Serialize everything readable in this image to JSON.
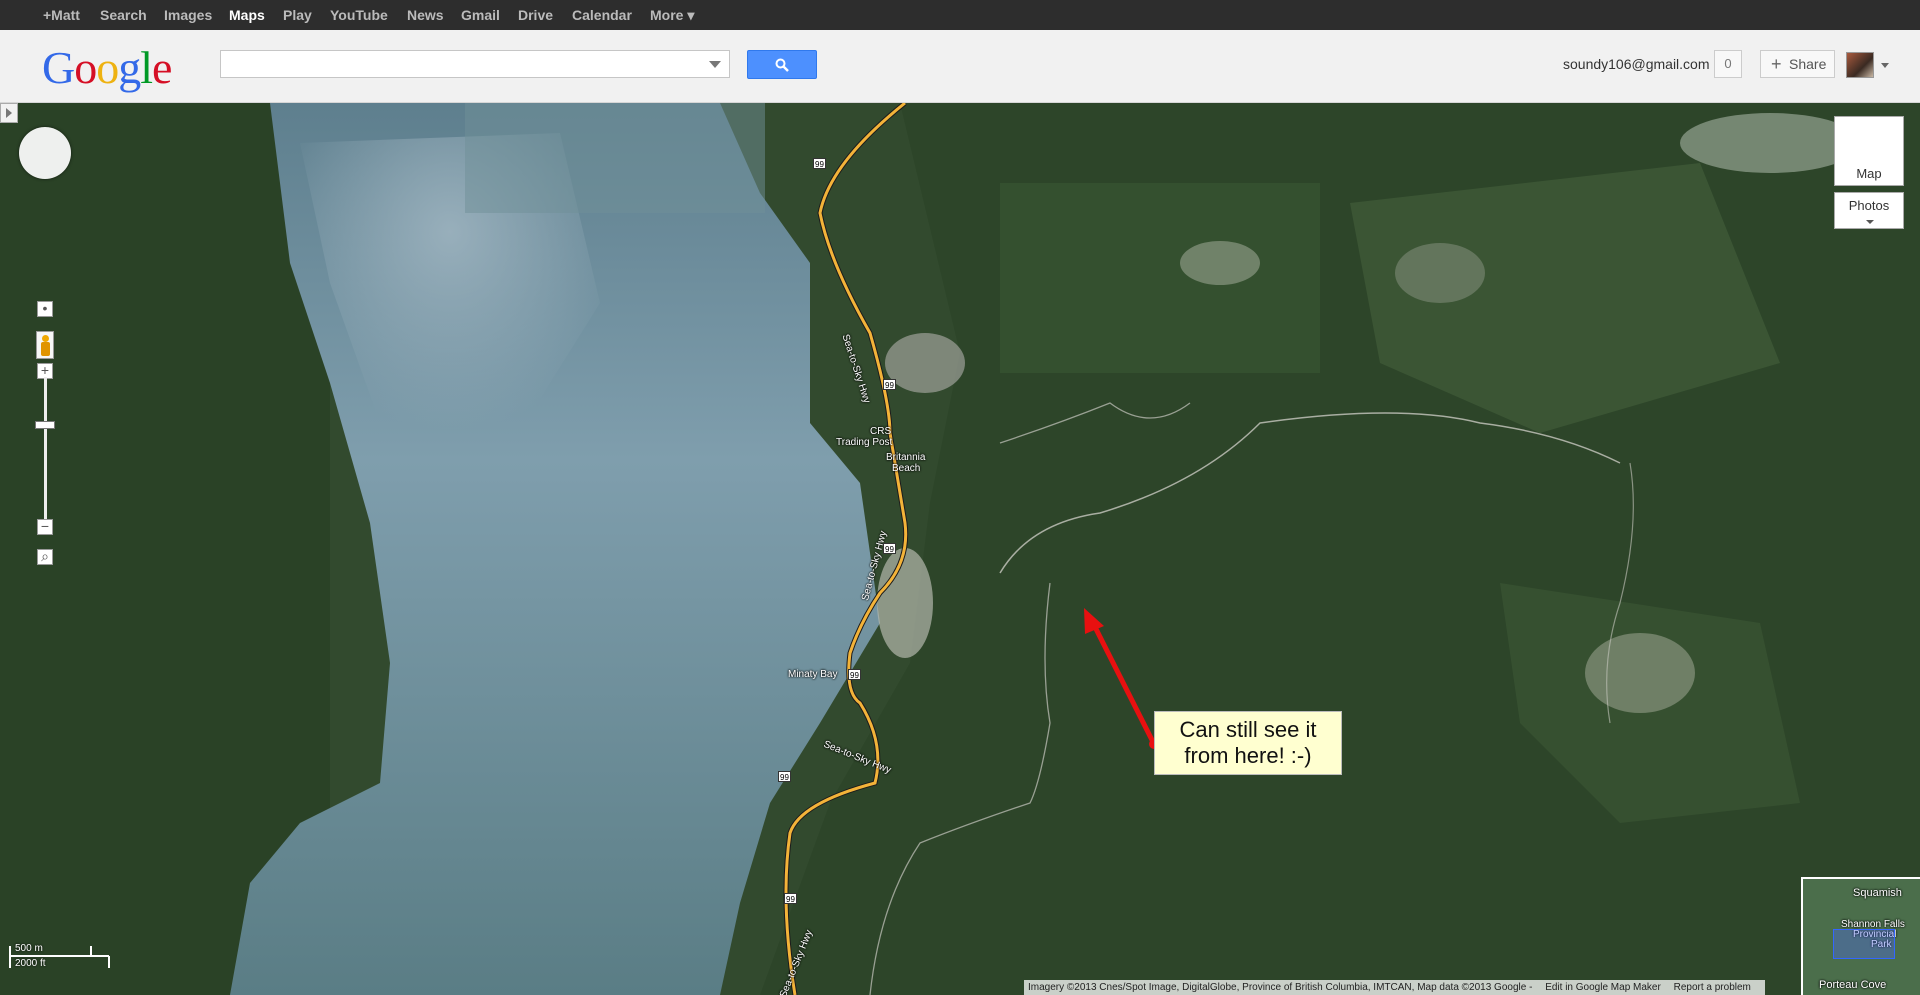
{
  "topbar": {
    "items": [
      "+Matt",
      "Search",
      "Images",
      "Maps",
      "Play",
      "YouTube",
      "News",
      "Gmail",
      "Drive",
      "Calendar",
      "More ▾"
    ],
    "active": "Maps"
  },
  "header": {
    "logo": "Google",
    "search": {
      "value": "",
      "placeholder": ""
    },
    "email": "soundy106@gmail.com",
    "notification_count": "0",
    "share_label": "Share"
  },
  "map": {
    "type_buttons": {
      "map": "Map",
      "photos": "Photos"
    },
    "places": {
      "crs": "CRS",
      "trading_post": "Trading Post",
      "britannia": "Britannia",
      "beach": "Beach",
      "minaty_bay": "Minaty Bay"
    },
    "road_name": "Sea-to-Sky Hwy",
    "highway_number": "99",
    "annotation": {
      "line1": "Can still see it",
      "line2": "from here! :-)"
    },
    "scale": {
      "metric": "500 m",
      "imperial": "2000 ft"
    },
    "footer": {
      "attribution": "Imagery ©2013 Cnes/Spot Image, DigitalGlobe, Province of British Columbia, IMTCAN, Map data ©2013 Google -",
      "edit": "Edit in Google Map Maker",
      "report": "Report a problem"
    },
    "overview": {
      "squamish": "Squamish",
      "park1": "Shannon Falls",
      "park2": "Provincial",
      "park3": "Park",
      "porteau": "Porteau Cove"
    }
  },
  "colors": {
    "search_button": "#4d90fe",
    "annotation_bg": "#ffffd0",
    "arrow": "#e81010",
    "highway": "#f3b339"
  }
}
